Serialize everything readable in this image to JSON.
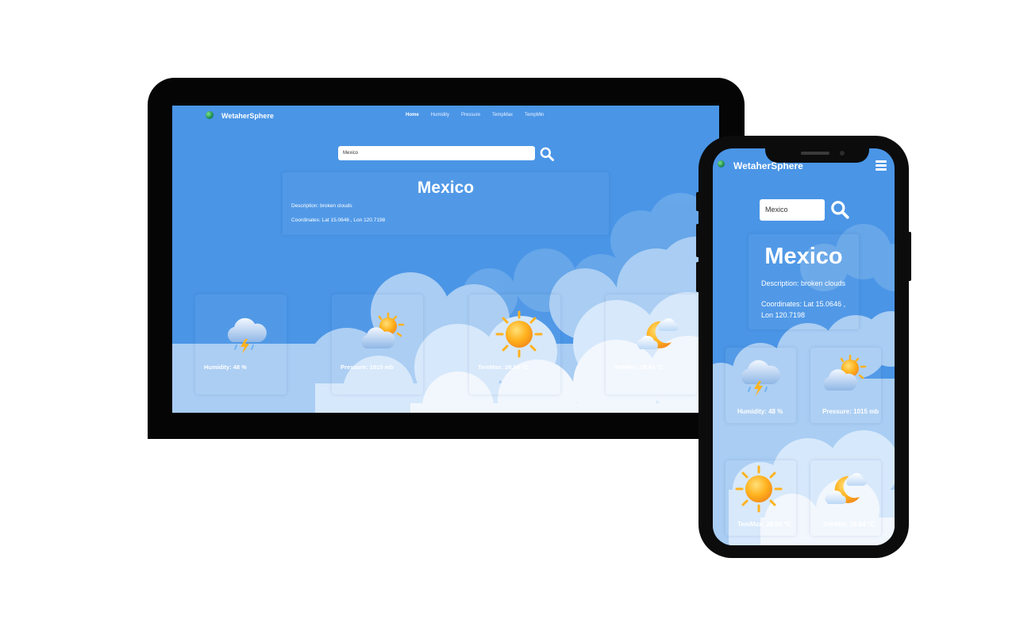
{
  "app": {
    "brand": "WetaherSphere"
  },
  "nav": {
    "links": [
      "Home",
      "Humidity",
      "Pressure",
      "TempMax",
      "TempMin"
    ]
  },
  "search": {
    "value": "Mexico"
  },
  "weather": {
    "city": "Mexico",
    "description": "Description: broken clouds",
    "coordinates": "Coordinates: Lat 15.0646 , Lon 120.7198"
  },
  "cards": [
    {
      "label": "Humidity: 48 %",
      "icon": "storm-cloud-icon"
    },
    {
      "label": "Pressure: 1015 mb",
      "icon": "partly-sunny-icon"
    },
    {
      "label": "TemMax: 28.84 °C",
      "icon": "sun-icon"
    },
    {
      "label": "TemMin: 28.84 °C",
      "icon": "moon-cloud-icon"
    }
  ],
  "colors": {
    "background": "#4a95e6",
    "device_frame": "#050505",
    "text": "#ffffff"
  }
}
